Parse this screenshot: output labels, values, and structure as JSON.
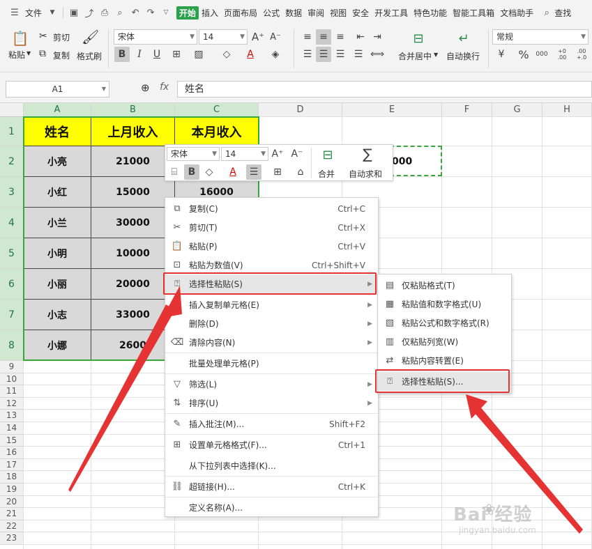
{
  "menubar": {
    "file": "文件",
    "tabs": [
      "开始",
      "插入",
      "页面布局",
      "公式",
      "数据",
      "审阅",
      "视图",
      "安全",
      "开发工具",
      "特色功能",
      "智能工具箱",
      "文档助手"
    ],
    "search": "查找"
  },
  "ribbon": {
    "paste": "粘贴",
    "cut": "剪切",
    "copy": "复制",
    "format_painter": "格式刷",
    "font_name": "宋体",
    "font_size": "14",
    "merge_center": "合并居中",
    "wrap_text": "自动换行",
    "number_format": "常规",
    "bold": "B",
    "italic": "I",
    "underline": "U",
    "percent": "%",
    "thousands": "000",
    "inc_decimal": "+0 .00",
    "dec_decimal": ".00 +.0"
  },
  "formula_bar": {
    "cell_ref": "A1",
    "fx": "fx",
    "value": "姓名"
  },
  "grid": {
    "columns": [
      "A",
      "B",
      "C",
      "D",
      "E",
      "F",
      "G",
      "H"
    ],
    "rows": [
      "1",
      "2",
      "3",
      "4",
      "5",
      "6",
      "7",
      "8",
      "9",
      "10",
      "11",
      "12",
      "13",
      "14",
      "15",
      "16",
      "17",
      "18",
      "19",
      "20",
      "21",
      "22",
      "23"
    ],
    "headers": [
      "姓名",
      "上月收入",
      "本月收入"
    ],
    "data": [
      [
        "小亮",
        "21000",
        ""
      ],
      [
        "小红",
        "15000",
        "16000"
      ],
      [
        "小兰",
        "30000",
        ""
      ],
      [
        "小明",
        "10000",
        ""
      ],
      [
        "小丽",
        "20000",
        ""
      ],
      [
        "小志",
        "33000",
        ""
      ],
      [
        "小娜",
        "2600",
        ""
      ]
    ],
    "e2_partial": "000"
  },
  "mini_toolbar": {
    "font_name": "宋体",
    "font_size": "14",
    "bold": "B",
    "merge": "合并",
    "autosum": "自动求和"
  },
  "context_menu": [
    {
      "label": "复制(C)",
      "shortcut": "Ctrl+C",
      "icon": "copy-icon"
    },
    {
      "label": "剪切(T)",
      "shortcut": "Ctrl+X",
      "icon": "scissors-icon"
    },
    {
      "label": "粘贴(P)",
      "shortcut": "Ctrl+V",
      "icon": "paste-icon"
    },
    {
      "label": "粘贴为数值(V)",
      "shortcut": "Ctrl+Shift+V",
      "icon": "paste-values-icon"
    },
    {
      "label": "选择性粘贴(S)",
      "shortcut": "",
      "icon": "paste-special-icon"
    },
    {
      "label": "插入复制单元格(E)",
      "shortcut": "",
      "icon": ""
    },
    {
      "label": "删除(D)",
      "shortcut": "",
      "icon": ""
    },
    {
      "label": "清除内容(N)",
      "shortcut": "",
      "icon": "eraser-icon"
    },
    {
      "label": "批量处理单元格(P)",
      "shortcut": "",
      "icon": ""
    },
    {
      "label": "筛选(L)",
      "shortcut": "",
      "icon": "filter-icon"
    },
    {
      "label": "排序(U)",
      "shortcut": "",
      "icon": "sort-icon"
    },
    {
      "label": "插入批注(M)...",
      "shortcut": "Shift+F2",
      "icon": "comment-icon"
    },
    {
      "label": "设置单元格格式(F)...",
      "shortcut": "Ctrl+1",
      "icon": "format-cells-icon"
    },
    {
      "label": "从下拉列表中选择(K)...",
      "shortcut": "",
      "icon": ""
    },
    {
      "label": "超链接(H)...",
      "shortcut": "Ctrl+K",
      "icon": "link-icon"
    },
    {
      "label": "定义名称(A)...",
      "shortcut": "",
      "icon": ""
    }
  ],
  "submenu": [
    {
      "label": "仅粘贴格式(T)",
      "icon": "paste-format-icon"
    },
    {
      "label": "粘贴值和数字格式(U)",
      "icon": "paste-value-number-icon"
    },
    {
      "label": "粘贴公式和数字格式(R)",
      "icon": "paste-formula-number-icon"
    },
    {
      "label": "仅粘贴列宽(W)",
      "icon": "paste-column-width-icon"
    },
    {
      "label": "粘贴内容转置(E)",
      "icon": "transpose-icon"
    },
    {
      "label": "选择性粘贴(S)...",
      "icon": "paste-special-icon"
    }
  ],
  "watermark": {
    "brand": "Bai 经验",
    "url": "jingyan.baidu.com"
  },
  "colors": {
    "accent": "#2aa14b",
    "header_fill": "#ffff00",
    "data_fill": "#d9d9d9",
    "selection": "#3aa53a",
    "annotation": "#e53333"
  }
}
